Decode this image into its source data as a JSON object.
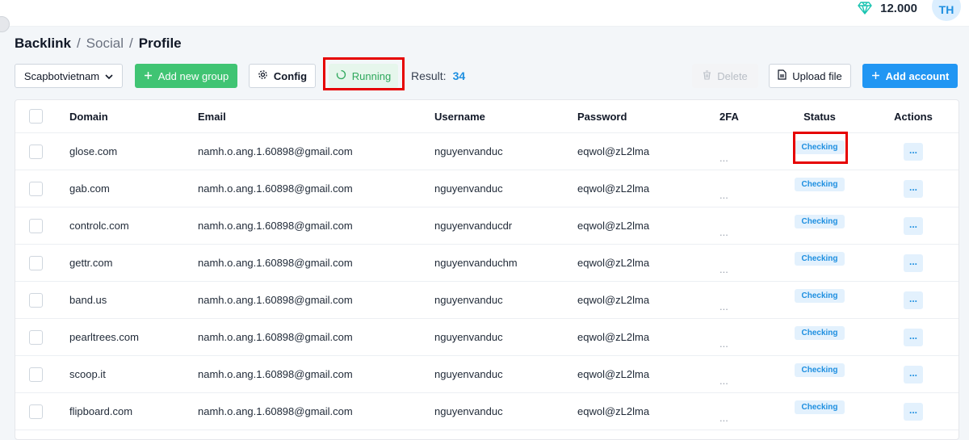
{
  "header": {
    "credits": "12.000",
    "avatar_initials": "TH",
    "accent": "#2196f3"
  },
  "breadcrumb": {
    "root": "Backlink",
    "sep1": "/",
    "mid": "Social",
    "sep2": "/",
    "current": "Profile"
  },
  "toolbar": {
    "group_select": "Scapbotvietnam",
    "add_group_label": "Add new group",
    "config_label": "Config",
    "running_label": "Running",
    "result_label": "Result:",
    "result_count": "34",
    "delete_label": "Delete",
    "upload_label": "Upload file",
    "add_account_label": "Add account"
  },
  "table": {
    "columns": {
      "domain": "Domain",
      "email": "Email",
      "username": "Username",
      "password": "Password",
      "twofa": "2FA",
      "status": "Status",
      "actions": "Actions"
    },
    "rows": [
      {
        "domain": "glose.com",
        "email": "namh.o.ang.1.60898@gmail.com",
        "username": "nguyenvanduc",
        "password": "eqwol@zL2lma",
        "twofa": "...",
        "status": "Checking",
        "actions": "..."
      },
      {
        "domain": "gab.com",
        "email": "namh.o.ang.1.60898@gmail.com",
        "username": "nguyenvanduc",
        "password": "eqwol@zL2lma",
        "twofa": "...",
        "status": "Checking",
        "actions": "..."
      },
      {
        "domain": "controlc.com",
        "email": "namh.o.ang.1.60898@gmail.com",
        "username": "nguyenvanducdr",
        "password": "eqwol@zL2lma",
        "twofa": "...",
        "status": "Checking",
        "actions": "..."
      },
      {
        "domain": "gettr.com",
        "email": "namh.o.ang.1.60898@gmail.com",
        "username": "nguyenvanduchm",
        "password": "eqwol@zL2lma",
        "twofa": "...",
        "status": "Checking",
        "actions": "..."
      },
      {
        "domain": "band.us",
        "email": "namh.o.ang.1.60898@gmail.com",
        "username": "nguyenvanduc",
        "password": "eqwol@zL2lma",
        "twofa": "...",
        "status": "Checking",
        "actions": "..."
      },
      {
        "domain": "pearltrees.com",
        "email": "namh.o.ang.1.60898@gmail.com",
        "username": "nguyenvanduc",
        "password": "eqwol@zL2lma",
        "twofa": "...",
        "status": "Checking",
        "actions": "..."
      },
      {
        "domain": "scoop.it",
        "email": "namh.o.ang.1.60898@gmail.com",
        "username": "nguyenvanduc",
        "password": "eqwol@zL2lma",
        "twofa": "...",
        "status": "Checking",
        "actions": "..."
      },
      {
        "domain": "flipboard.com",
        "email": "namh.o.ang.1.60898@gmail.com",
        "username": "nguyenvanduc",
        "password": "eqwol@zL2lma",
        "twofa": "...",
        "status": "Checking",
        "actions": "..."
      }
    ]
  }
}
